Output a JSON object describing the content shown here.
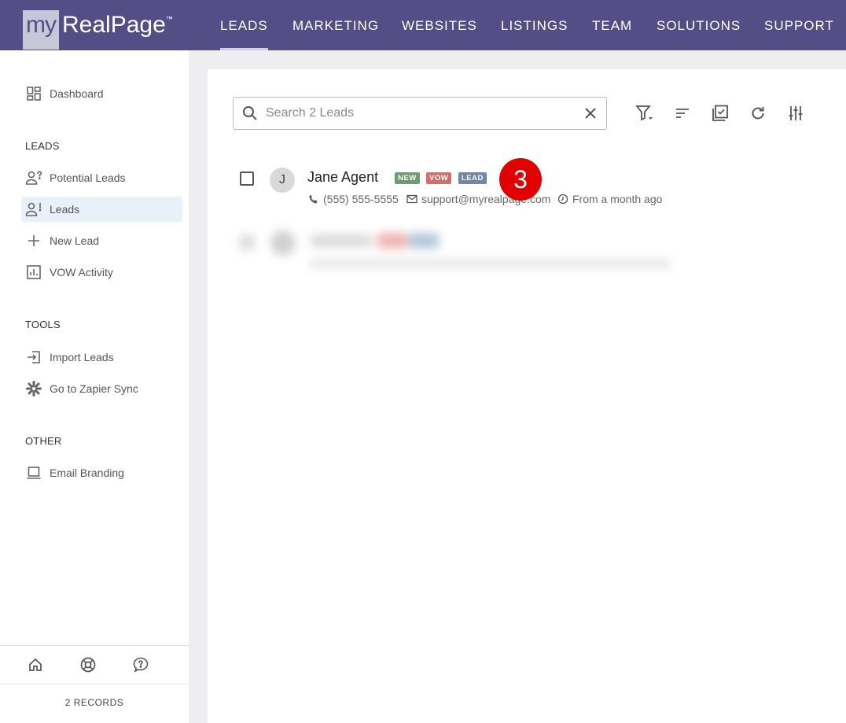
{
  "brand": {
    "my": "my",
    "name": "RealPage",
    "tm": "™"
  },
  "nav": {
    "tabs": [
      {
        "label": "LEADS",
        "active": true
      },
      {
        "label": "MARKETING"
      },
      {
        "label": "WEBSITES"
      },
      {
        "label": "LISTINGS"
      },
      {
        "label": "TEAM"
      },
      {
        "label": "SOLUTIONS"
      },
      {
        "label": "SUPPORT"
      }
    ]
  },
  "sidebar": {
    "dashboard": {
      "label": "Dashboard",
      "icon": "dashboard-icon"
    },
    "leads_heading": "LEADS",
    "leads_items": [
      {
        "label": "Potential Leads",
        "icon": "person-question-icon"
      },
      {
        "label": "Leads",
        "icon": "person-exclamation-icon",
        "active": true
      },
      {
        "label": "New Lead",
        "icon": "plus-icon"
      },
      {
        "label": "VOW Activity",
        "icon": "bar-chart-icon"
      }
    ],
    "tools_heading": "TOOLS",
    "tools_items": [
      {
        "label": "Import Leads",
        "icon": "import-icon"
      },
      {
        "label": "Go to Zapier Sync",
        "icon": "zapier-icon"
      }
    ],
    "other_heading": "OTHER",
    "other_items": [
      {
        "label": "Email Branding",
        "icon": "laptop-icon"
      }
    ],
    "footer": {
      "records": "2 RECORDS"
    }
  },
  "main": {
    "search": {
      "placeholder": "Search 2 Leads",
      "value": ""
    },
    "lead": {
      "avatar_initial": "J",
      "name": "Jane Agent",
      "badges": [
        {
          "label": "NEW",
          "color": "#6e9a74"
        },
        {
          "label": "VOW",
          "color": "#d66d6d"
        },
        {
          "label": "LEAD",
          "color": "#6c89a5"
        }
      ],
      "phone": "(555) 555-5555",
      "email": "support@myrealpage.com",
      "time": "From a month ago"
    },
    "step_marker": "3"
  },
  "colors": {
    "nav_bg": "#544d86",
    "active_item_bg": "#e8f0fa",
    "marker": "#e10000"
  }
}
